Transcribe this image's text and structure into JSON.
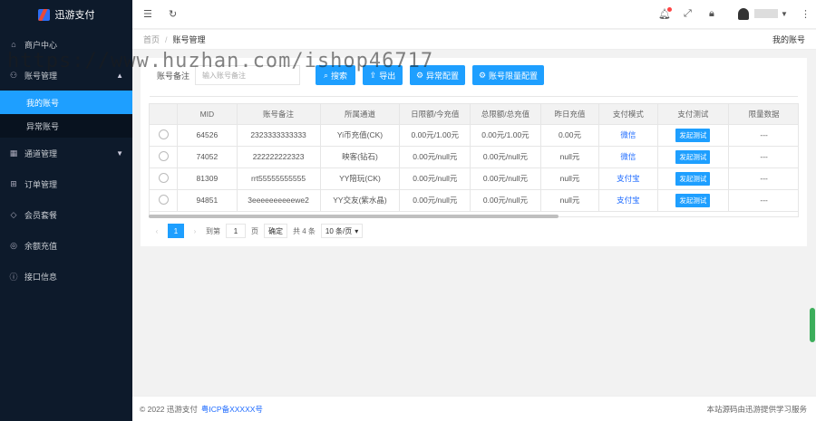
{
  "app": {
    "title": "迅游支付"
  },
  "sidebar": {
    "items": [
      {
        "label": "商户中心",
        "icon": "home-icon"
      },
      {
        "label": "账号管理",
        "icon": "user-icon",
        "expanded": true,
        "children": [
          {
            "label": "我的账号",
            "active": true
          },
          {
            "label": "异常账号"
          }
        ]
      },
      {
        "label": "通道管理",
        "icon": "channel-icon"
      },
      {
        "label": "订单管理",
        "icon": "cart-icon"
      },
      {
        "label": "会员套餐",
        "icon": "diamond-icon"
      },
      {
        "label": "余额充值",
        "icon": "coin-icon"
      },
      {
        "label": "接口信息",
        "icon": "info-icon"
      }
    ]
  },
  "breadcrumb": {
    "home": "首页",
    "separator": "/",
    "current": "账号管理",
    "right": "我的账号"
  },
  "toolbar": {
    "field_label": "账号备注",
    "placeholder": "输入账号备注",
    "search": "搜索",
    "export": "导出",
    "abnormal_config": "异常配置",
    "limit_config": "账号限量配置"
  },
  "table": {
    "headers": [
      "",
      "MID",
      "账号备注",
      "所属通道",
      "日限额/今充值",
      "总限额/总充值",
      "昨日充值",
      "支付模式",
      "支付测试",
      "限量数据"
    ],
    "rows": [
      {
        "mid": "64526",
        "note": "2323333333333",
        "channel": "Yi币充值(CK)",
        "daily": "0.00元/1.00元",
        "total": "0.00元/1.00元",
        "yesterday": "0.00元",
        "mode": "微信",
        "test": "发起测试",
        "limit": "---"
      },
      {
        "mid": "74052",
        "note": "222222222323",
        "channel": "映客(钻石)",
        "daily": "0.00元/null元",
        "total": "0.00元/null元",
        "yesterday": "null元",
        "mode": "微信",
        "test": "发起测试",
        "limit": "---"
      },
      {
        "mid": "81309",
        "note": "rrt55555555555",
        "channel": "YY陪玩(CK)",
        "daily": "0.00元/null元",
        "total": "0.00元/null元",
        "yesterday": "null元",
        "mode": "支付宝",
        "test": "发起测试",
        "limit": "---"
      },
      {
        "mid": "94851",
        "note": "3eeeeeeeeeewe2",
        "channel": "YY交友(紫水晶)",
        "daily": "0.00元/null元",
        "total": "0.00元/null元",
        "yesterday": "null元",
        "mode": "支付宝",
        "test": "发起测试",
        "limit": "---"
      }
    ]
  },
  "pager": {
    "prev": "‹",
    "current": "1",
    "next": "›",
    "goto_label": "到第",
    "goto_value": "1",
    "page_unit": "页",
    "confirm": "确定",
    "total": "共 4 条",
    "per_page": "10 条/页"
  },
  "footer": {
    "copyright": "© 2022 迅游支付",
    "icp": "粤ICP备XXXXX号",
    "right": "本站源码由迅游提供学习服务"
  },
  "watermark": "https://www.huzhan.com/ishop46717",
  "colors": {
    "accent": "#1e9fff",
    "sidebar_bg": "#0d1a2b",
    "link": "#1e6bff"
  }
}
